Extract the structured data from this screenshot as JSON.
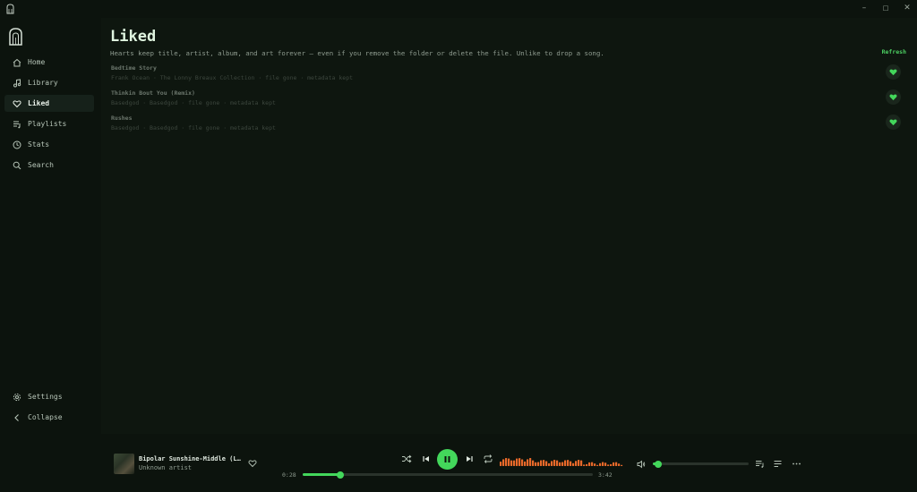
{
  "window": {
    "minimize": "–",
    "maximize": "□",
    "close": "✕"
  },
  "sidebar": {
    "items": [
      {
        "label": "Home",
        "icon": "home-icon",
        "active": false
      },
      {
        "label": "Library",
        "icon": "music-note-icon",
        "active": false
      },
      {
        "label": "Liked",
        "icon": "heart-icon",
        "active": true
      },
      {
        "label": "Playlists",
        "icon": "playlist-icon",
        "active": false
      },
      {
        "label": "Stats",
        "icon": "clock-icon",
        "active": false
      },
      {
        "label": "Search",
        "icon": "search-icon",
        "active": false
      }
    ],
    "bottom": [
      {
        "label": "Settings",
        "icon": "gear-icon"
      },
      {
        "label": "Collapse",
        "icon": "chevron-left-icon"
      }
    ]
  },
  "main": {
    "title": "Liked",
    "description": "Hearts keep title, artist, album, and art forever — even if you remove the folder or delete the file. Unlike to drop a song.",
    "refresh_label": "Refresh",
    "songs": [
      {
        "title": "Bedtime Story",
        "meta": "Frank Ocean · The Lonny Breaux Collection · file gone · metadata kept"
      },
      {
        "title": "Thinkin Bout You (Remix)",
        "meta": "Basedgod · Basedgod · file gone · metadata kept"
      },
      {
        "title": "Rushes",
        "meta": "Basedgod · Basedgod · file gone · metadata kept"
      }
    ]
  },
  "player": {
    "title": "Bipolar Sunshine-Middle (L…",
    "artist": "Unknown artist",
    "elapsed": "0:28",
    "duration": "3:42",
    "progress_fraction": 0.13,
    "volume_fraction": 0.06,
    "accent_color": "#43d75b",
    "wave_color": "#e8692a"
  }
}
